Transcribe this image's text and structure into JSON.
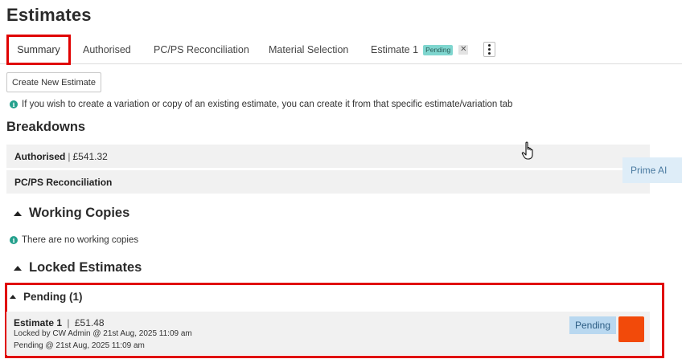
{
  "page": {
    "title": "Estimates"
  },
  "tabs": [
    {
      "label": "Summary",
      "active": true
    },
    {
      "label": "Authorised"
    },
    {
      "label": "PC/PS Reconciliation"
    },
    {
      "label": "Material Selection"
    },
    {
      "label": "Estimate 1",
      "badge": "Pending",
      "closable": true
    }
  ],
  "toolbar": {
    "create_label": "Create New Estimate",
    "more_icon": "kebab-menu-icon"
  },
  "info": {
    "variation_note": "If you wish to create a variation or copy of an existing estimate, you can create it from that specific estimate/variation tab",
    "icon": "info-icon"
  },
  "breakdowns": {
    "heading": "Breakdowns",
    "rows": [
      {
        "label": "Authorised",
        "separator": "|",
        "amount": "£541.32"
      },
      {
        "label": "PC/PS Reconciliation"
      }
    ]
  },
  "prime_ai": {
    "label": "Prime AI"
  },
  "working_copies": {
    "heading": "Working Copies",
    "empty_text": "There are no working copies"
  },
  "locked_estimates": {
    "heading": "Locked Estimates",
    "pending_group": {
      "label": "Pending (1)"
    },
    "estimates": [
      {
        "name": "Estimate 1",
        "separator": "|",
        "amount": "£51.48",
        "locked_by": "Locked by CW Admin @ 21st Aug, 2025 11:09 am",
        "pending_at": "Pending @ 21st Aug, 2025 11:09 am",
        "status": "Pending"
      }
    ]
  },
  "colors": {
    "highlight_red": "#e00000",
    "accent_orange": "#f24a0a",
    "badge_teal": "#7fd6cf",
    "status_blue": "#b9d8f0",
    "info_green": "#23a08c"
  }
}
